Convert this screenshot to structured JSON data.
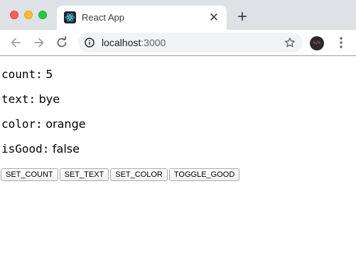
{
  "browser": {
    "tab": {
      "title": "React App",
      "favicon": "react-logo-icon",
      "close_glyph": "✕"
    },
    "new_tab_glyph": "+",
    "address": {
      "host": "localhost",
      "port": ":3000"
    },
    "colors": {
      "tabstrip": "#dee1e6",
      "traffic_close": "#ff5f57",
      "traffic_min": "#febc2e",
      "traffic_max": "#28c840",
      "react_cyan": "#61dafb"
    }
  },
  "page": {
    "state": [
      {
        "key": "count:",
        "value": "5"
      },
      {
        "key": "text:",
        "value": "bye"
      },
      {
        "key": "color:",
        "value": "orange"
      },
      {
        "key": "isGood:",
        "value": "false"
      }
    ],
    "buttons": [
      {
        "label": "SET_COUNT"
      },
      {
        "label": "SET_TEXT"
      },
      {
        "label": "SET_COLOR"
      },
      {
        "label": "TOGGLE_GOOD"
      }
    ]
  }
}
